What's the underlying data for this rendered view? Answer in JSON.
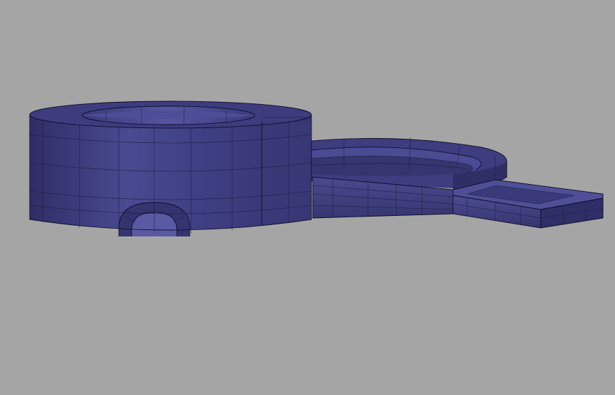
{
  "viewport": {
    "background_color": "#a5a5a5",
    "model_color": "#3f3f84",
    "model_highlight_color": "#5a5aa6",
    "model_shadow_color": "#2c2c62",
    "wire_color": "#0f0f2a"
  }
}
